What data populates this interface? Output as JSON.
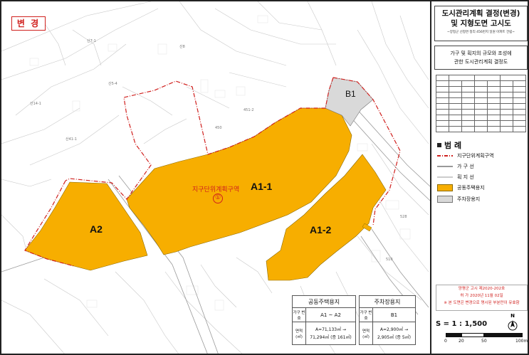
{
  "stamp": "변 경",
  "title": {
    "line1": "도시관리계획 결정(변경)",
    "line2": "및 지형도면 고시도",
    "sub": "~양정군 선정면 정리 456번지 일원 아파트 건립~"
  },
  "description": {
    "line1": "가구 및 획지의 규모와 조성에",
    "line2": "관한 도시관리계획 결정도"
  },
  "map": {
    "stamp_color": "#d0201e",
    "housing_color": "#f7ae00",
    "parking_color": "#d9d9d9",
    "boundary_color": "#d0201e",
    "labels": {
      "a1_1": "A1-1",
      "a1_2": "A1-2",
      "a2": "A2",
      "b1": "B1",
      "district": "지구단위계획구역",
      "district_no": "①"
    },
    "lot_numbers": [
      "산7-1",
      "산5-4",
      "산41-1",
      "450",
      "451-2",
      "산14-1",
      "산8",
      "528",
      "510"
    ]
  },
  "legend": {
    "title": "범 례",
    "items": [
      {
        "label": "지구단위계획구역",
        "type": "boundary"
      },
      {
        "label": "가 구 선",
        "type": "block-line"
      },
      {
        "label": "획 지 선",
        "type": "lot-line"
      },
      {
        "label": "공동주택용지",
        "type": "housing"
      },
      {
        "label": "주차장용지",
        "type": "parking"
      }
    ]
  },
  "housing_table": {
    "header": "공동주택용지",
    "row1_label": "가구 번호",
    "row1_value": "A1 ~ A2",
    "row2_label": "면적 (㎡)",
    "row2_line1": "A=71,133㎡ →",
    "row2_line2": "71,294㎡ (증 161㎡)"
  },
  "parking_table": {
    "header": "주차장용지",
    "row1_label": "가구 번호",
    "row1_value": "B1",
    "row2_label": "면적 (㎡)",
    "row2_line1": "A=2,900㎡ →",
    "row2_line2": "2,905㎡ (증 5㎡)"
  },
  "notice": {
    "line1": "양평군 고시 제2020-202호",
    "line2": "허 가 2020년 11월 02일",
    "line3": "※ 본 도면은 변경으로 명시된 부분만이 유효함"
  },
  "north": "N",
  "scale": {
    "text": "S = 1 : 1,500",
    "ticks": [
      "0",
      "20",
      "50",
      "100m"
    ]
  }
}
